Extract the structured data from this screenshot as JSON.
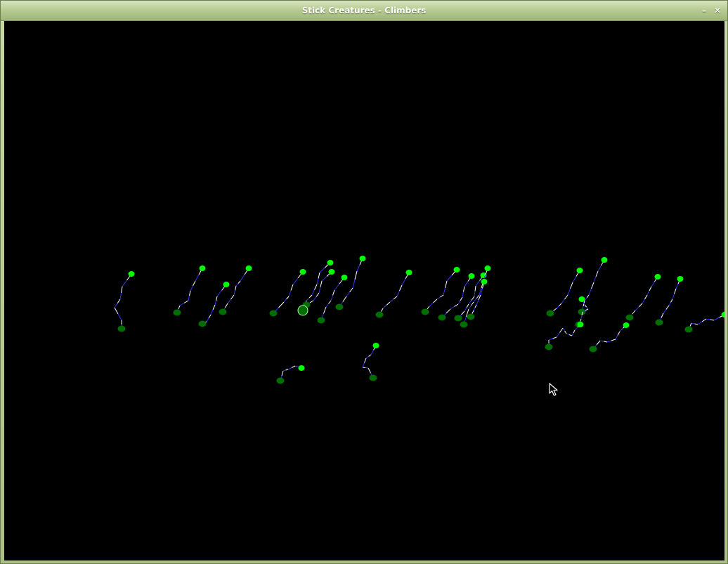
{
  "window": {
    "title": "Stick Creatures - Climbers",
    "minimize_glyph": "–",
    "close_glyph": "✕"
  },
  "icons": {
    "minimize": "minimize-icon",
    "close": "close-icon",
    "cursor": "mouse-pointer-icon"
  },
  "colors": {
    "canvas_background": "#000000",
    "head": "#00ff00",
    "foot": "#006e00",
    "limb_light": "#ffffff",
    "limb_dark": "#3333ff"
  }
}
